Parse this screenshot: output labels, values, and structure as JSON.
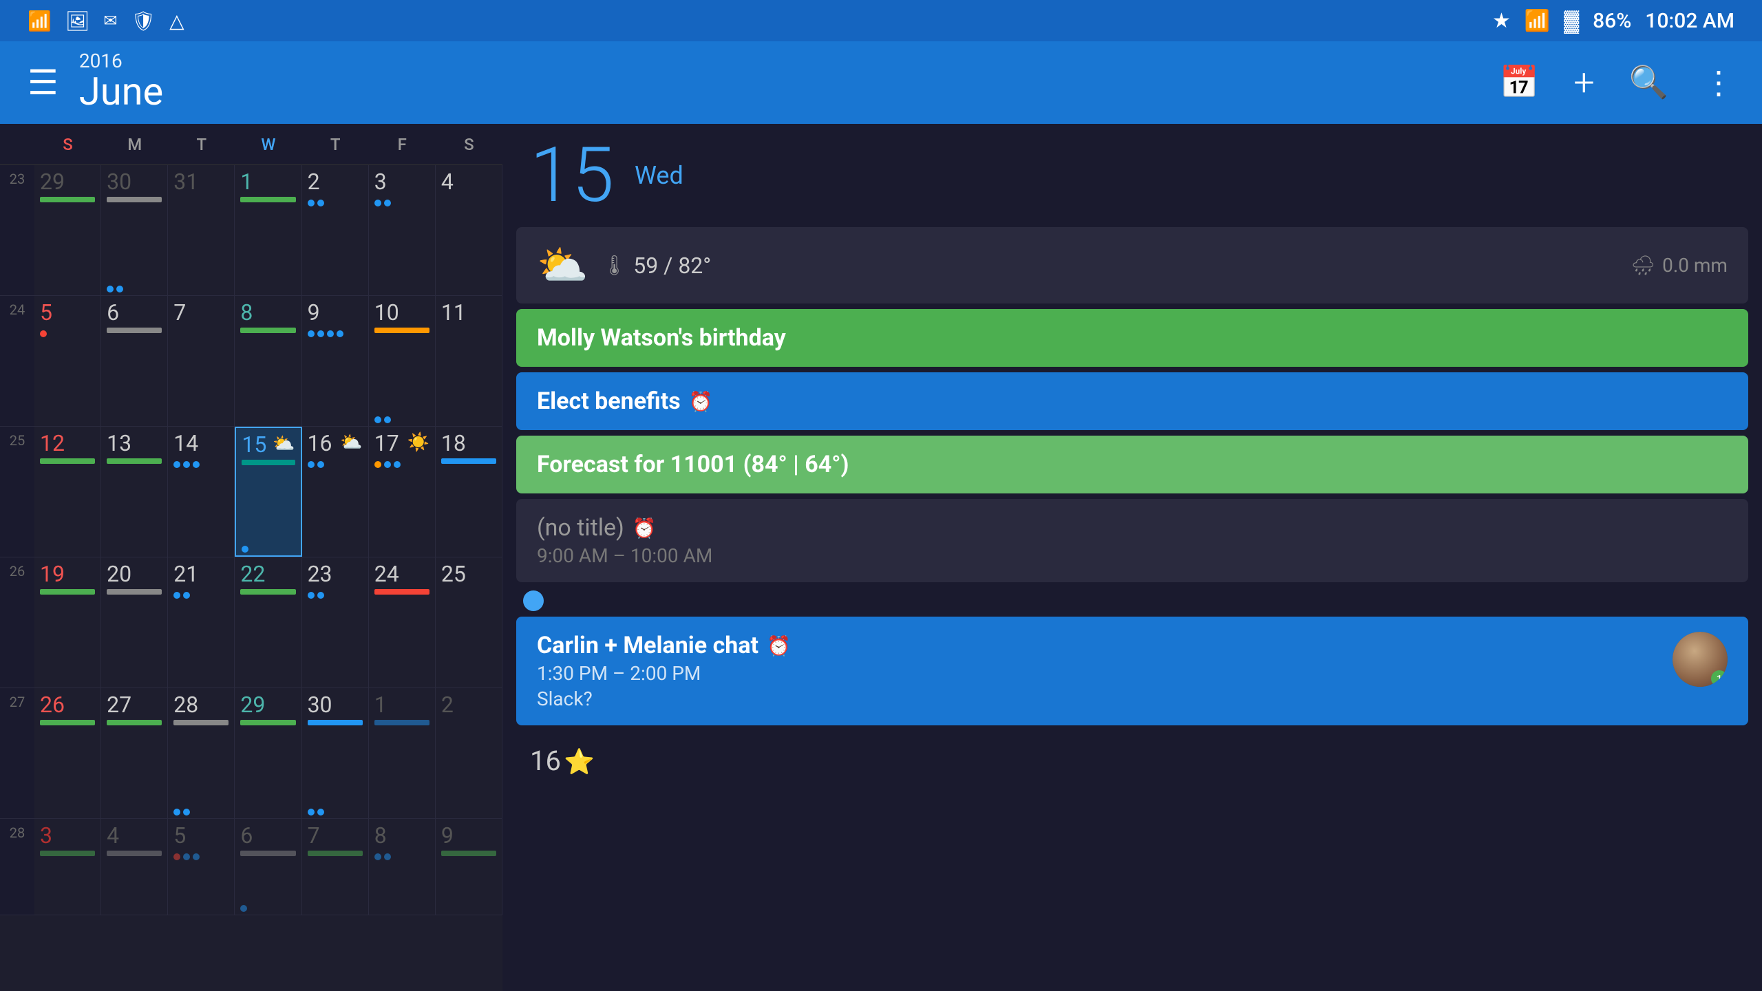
{
  "statusBar": {
    "time": "10:02 AM",
    "battery": "86%",
    "icons": [
      "wifi",
      "bluetooth",
      "signal",
      "battery"
    ]
  },
  "toolbar": {
    "year": "2016",
    "month": "June",
    "menuIcon": "☰",
    "calendarIcon": "📅",
    "addIcon": "+",
    "searchIcon": "🔍",
    "moreIcon": "⋮"
  },
  "dayHeaders": [
    "S",
    "M",
    "T",
    "W",
    "T",
    "F",
    "S"
  ],
  "weeks": [
    {
      "weekNum": "23",
      "days": [
        {
          "num": "29",
          "type": "other",
          "dow": "sun",
          "bars": [
            "green"
          ],
          "dots": []
        },
        {
          "num": "30",
          "type": "other",
          "dow": "mon",
          "bars": [
            "gray"
          ],
          "dots": [
            "blue",
            "blue"
          ]
        },
        {
          "num": "31",
          "type": "other",
          "dow": "tue",
          "bars": [],
          "dots": []
        },
        {
          "num": "1",
          "type": "current",
          "dow": "wed",
          "bars": [
            "green"
          ],
          "dots": []
        },
        {
          "num": "2",
          "type": "current",
          "dow": "thu",
          "bars": [],
          "dots": [
            "blue",
            "blue"
          ]
        },
        {
          "num": "3",
          "type": "current",
          "dow": "fri",
          "bars": [],
          "dots": [
            "blue",
            "blue"
          ]
        },
        {
          "num": "4",
          "type": "current",
          "dow": "sat",
          "bars": [],
          "dots": []
        }
      ]
    },
    {
      "weekNum": "24",
      "days": [
        {
          "num": "5",
          "type": "current",
          "dow": "sun",
          "bars": [],
          "dots": [
            "red"
          ]
        },
        {
          "num": "6",
          "type": "current",
          "dow": "mon",
          "bars": [
            "gray"
          ],
          "dots": []
        },
        {
          "num": "7",
          "type": "current",
          "dow": "tue",
          "bars": [],
          "dots": []
        },
        {
          "num": "8",
          "type": "current",
          "dow": "wed",
          "bars": [
            "green"
          ],
          "dots": []
        },
        {
          "num": "9",
          "type": "current",
          "dow": "thu",
          "bars": [],
          "dots": [
            "blue",
            "blue",
            "blue",
            "blue"
          ]
        },
        {
          "num": "10",
          "type": "current",
          "dow": "fri",
          "bars": [
            "orange"
          ],
          "dots": [
            "blue",
            "blue"
          ]
        },
        {
          "num": "11",
          "type": "current",
          "dow": "sat",
          "bars": [],
          "dots": []
        }
      ]
    },
    {
      "weekNum": "25",
      "days": [
        {
          "num": "12",
          "type": "current",
          "dow": "sun",
          "bars": [
            "green"
          ],
          "dots": []
        },
        {
          "num": "13",
          "type": "current",
          "dow": "mon",
          "bars": [
            "green"
          ],
          "dots": []
        },
        {
          "num": "14",
          "type": "current",
          "dow": "tue",
          "bars": [],
          "dots": [
            "blue",
            "blue",
            "blue"
          ]
        },
        {
          "num": "15",
          "type": "today",
          "dow": "wed",
          "bars": [
            "teal"
          ],
          "dots": [
            "blue"
          ],
          "weather": "⛅"
        },
        {
          "num": "16",
          "type": "current",
          "dow": "thu",
          "bars": [],
          "dots": [
            "blue",
            "blue"
          ],
          "weather": "⛅"
        },
        {
          "num": "17",
          "type": "current",
          "dow": "fri",
          "bars": [],
          "dots": [
            "orange",
            "blue",
            "blue"
          ],
          "weather": "☀️"
        },
        {
          "num": "18",
          "type": "current",
          "dow": "sat",
          "bars": [
            "blue"
          ],
          "dots": []
        }
      ]
    },
    {
      "weekNum": "26",
      "days": [
        {
          "num": "19",
          "type": "current",
          "dow": "sun",
          "bars": [
            "green"
          ],
          "dots": []
        },
        {
          "num": "20",
          "type": "current",
          "dow": "mon",
          "bars": [
            "gray"
          ],
          "dots": []
        },
        {
          "num": "21",
          "type": "current",
          "dow": "tue",
          "bars": [],
          "dots": [
            "blue",
            "blue"
          ]
        },
        {
          "num": "22",
          "type": "current",
          "dow": "wed",
          "bars": [
            "green"
          ],
          "dots": []
        },
        {
          "num": "23",
          "type": "current",
          "dow": "thu",
          "bars": [],
          "dots": [
            "blue",
            "blue"
          ]
        },
        {
          "num": "24",
          "type": "current",
          "dow": "fri",
          "bars": [
            "red"
          ],
          "dots": []
        },
        {
          "num": "25",
          "type": "current",
          "dow": "sat",
          "bars": [],
          "dots": []
        }
      ]
    },
    {
      "weekNum": "27",
      "days": [
        {
          "num": "26",
          "type": "current",
          "dow": "sun",
          "bars": [
            "green"
          ],
          "dots": []
        },
        {
          "num": "27",
          "type": "current",
          "dow": "mon",
          "bars": [
            "green"
          ],
          "dots": []
        },
        {
          "num": "28",
          "type": "current",
          "dow": "tue",
          "bars": [
            "gray"
          ],
          "dots": [
            "blue",
            "blue"
          ]
        },
        {
          "num": "29",
          "type": "current",
          "dow": "wed",
          "bars": [
            "green"
          ],
          "dots": []
        },
        {
          "num": "30",
          "type": "current",
          "dow": "thu",
          "bars": [
            "blue"
          ],
          "dots": [
            "blue",
            "blue"
          ]
        },
        {
          "num": "1",
          "type": "other",
          "dow": "fri",
          "bars": [
            "blue"
          ],
          "dots": []
        },
        {
          "num": "2",
          "type": "other",
          "dow": "sat",
          "bars": [],
          "dots": []
        }
      ]
    },
    {
      "weekNum": "28",
      "days": [
        {
          "num": "3",
          "type": "other",
          "dow": "sun",
          "bars": [
            "green"
          ],
          "dots": []
        },
        {
          "num": "4",
          "type": "other",
          "dow": "mon",
          "bars": [
            "gray"
          ],
          "dots": []
        },
        {
          "num": "5",
          "type": "other",
          "dow": "tue",
          "bars": [],
          "dots": [
            "red",
            "blue",
            "blue"
          ]
        },
        {
          "num": "6",
          "type": "other",
          "dow": "wed",
          "bars": [
            "gray"
          ],
          "dots": [
            "blue"
          ]
        },
        {
          "num": "7",
          "type": "other",
          "dow": "thu",
          "bars": [
            "green"
          ],
          "dots": []
        },
        {
          "num": "8",
          "type": "other",
          "dow": "fri",
          "bars": [],
          "dots": [
            "blue",
            "blue"
          ]
        },
        {
          "num": "9",
          "type": "other",
          "dow": "sat",
          "bars": [
            "green"
          ],
          "dots": []
        }
      ]
    }
  ],
  "dateDisplay": {
    "dayNum": "15",
    "dayName": "Wed"
  },
  "weather": {
    "icon": "⛅",
    "tempRange": "59 / 82°",
    "precipitation": "0.0 mm"
  },
  "events": [
    {
      "id": "birthday",
      "type": "birthday",
      "title": "Molly Watson's birthday"
    },
    {
      "id": "benefits",
      "type": "benefits",
      "title": "Elect benefits",
      "hasAlarm": true
    },
    {
      "id": "forecast",
      "type": "forecast",
      "title": "Forecast for 11001 (84° | 64°)"
    },
    {
      "id": "no-title",
      "type": "no-title",
      "title": "(no title)",
      "hasAlarm": true,
      "time": "9:00 AM – 10:00 AM"
    },
    {
      "id": "chat",
      "type": "chat",
      "title": "Carlin + Melanie chat",
      "hasAlarm": true,
      "time": "1:30 PM – 2:00 PM",
      "subtitle": "Slack?",
      "hasAvatar": true,
      "avatarBadge": "1"
    }
  ],
  "day16": {
    "num": "16",
    "starIcon": "⭐"
  }
}
